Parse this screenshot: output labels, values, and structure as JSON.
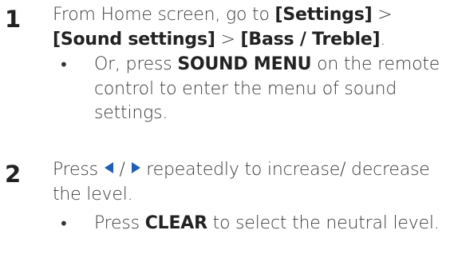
{
  "step1": {
    "number": "1",
    "text_part1": "From Home screen, go to ",
    "settings": "[Settings]",
    "sep1": " > ",
    "sound_settings": "[Sound settings]",
    "sep2": " > ",
    "bass_treble": "[Bass / Treble]",
    "period": ".",
    "bullet": {
      "prefix": "Or, press ",
      "key": "SOUND MENU",
      "suffix": " on the remote control to enter the menu of sound settings."
    }
  },
  "step2": {
    "number": "2",
    "press": "Press ",
    "slash": " / ",
    "text_rest": " repeatedly to increase/ decrease the level.",
    "bullet": {
      "prefix": "Press ",
      "key": "CLEAR",
      "suffix": " to select the neutral level."
    }
  },
  "colors": {
    "text": "#3a3a3a",
    "heading": "#222222",
    "arrow": "#1f5fb8"
  },
  "icons": [
    "left-arrow-icon",
    "right-arrow-icon",
    "bullet-dot"
  ]
}
